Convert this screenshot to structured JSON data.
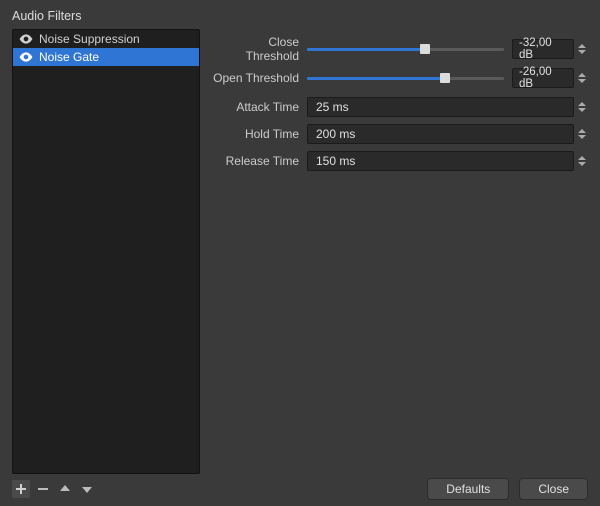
{
  "title": "Audio Filters",
  "filters": [
    {
      "label": "Noise Suppression",
      "selected": false
    },
    {
      "label": "Noise Gate",
      "selected": true
    }
  ],
  "params": {
    "closeThreshold": {
      "label": "Close Threshold",
      "value": "-32,00 dB",
      "fillPercent": 60
    },
    "openThreshold": {
      "label": "Open Threshold",
      "value": "-26,00 dB",
      "fillPercent": 70
    },
    "attackTime": {
      "label": "Attack Time",
      "value": "25 ms"
    },
    "holdTime": {
      "label": "Hold Time",
      "value": "200 ms"
    },
    "releaseTime": {
      "label": "Release Time",
      "value": "150 ms"
    }
  },
  "buttons": {
    "defaults": "Defaults",
    "close": "Close"
  },
  "icons": {
    "eye": "eye-icon",
    "plus": "plus-icon",
    "minus": "minus-icon",
    "up": "move-up-icon",
    "down": "move-down-icon"
  }
}
